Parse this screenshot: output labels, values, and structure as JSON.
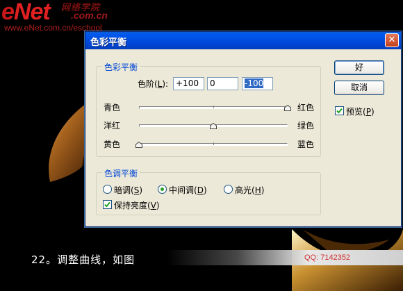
{
  "watermark": {
    "logo_e": "e",
    "logo_net": "Net",
    "logo_cn": "网络学院",
    "logo_com": ".com.cn",
    "url": "www.eNet.com.cn/eschool"
  },
  "caption": "22。调整曲线，如图",
  "qq_text": "QQ: 7142352",
  "dialog": {
    "title": "色彩平衡",
    "close_glyph": "✕",
    "color_balance": {
      "legend": "色彩平衡",
      "levels_label": "色阶(L):",
      "levels_label_pre": "色阶(",
      "levels_label_key": "L",
      "levels_label_post": "):",
      "values": [
        "+100",
        "0",
        "-100"
      ],
      "sliders": [
        {
          "left": "青色",
          "right": "红色",
          "value": 100
        },
        {
          "left": "洋红",
          "right": "绿色",
          "value": 0
        },
        {
          "left": "黄色",
          "right": "蓝色",
          "value": -100
        }
      ]
    },
    "tone_balance": {
      "legend": "色调平衡",
      "options": [
        {
          "pre": "暗调(",
          "key": "S",
          "post": ")",
          "selected": false
        },
        {
          "pre": "中间调(",
          "key": "D",
          "post": ")",
          "selected": true
        },
        {
          "pre": "高光(",
          "key": "H",
          "post": ")",
          "selected": false
        }
      ],
      "preserve_luminosity": {
        "pre": "保持亮度(",
        "key": "V",
        "post": ")",
        "checked": true
      }
    },
    "ok_label": "好",
    "cancel_label": "取消",
    "preview": {
      "pre": "预览(",
      "key": "P",
      "post": ")",
      "checked": true
    }
  },
  "colors": {
    "title_bar": "#0046d5",
    "dialog_bg": "#ece9d8",
    "legend_text": "#0046d5",
    "selection": "#316ac5"
  }
}
